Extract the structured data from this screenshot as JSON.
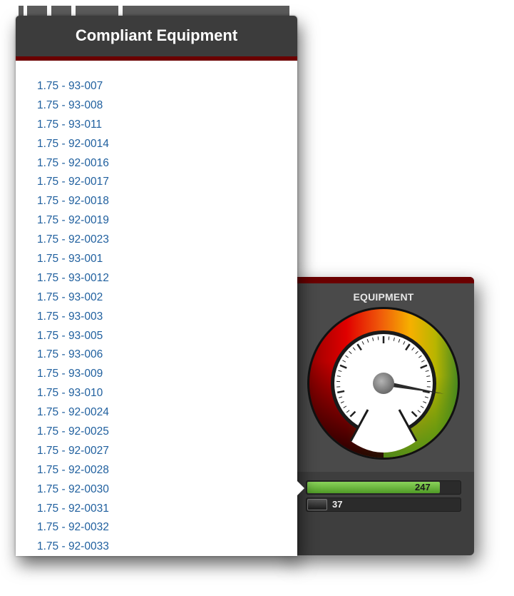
{
  "popup": {
    "title": "Compliant Equipment",
    "items": [
      "1.75 - 93-007",
      "1.75 - 93-008",
      "1.75 - 93-011",
      "1.75 - 92-0014",
      "1.75 - 92-0016",
      "1.75 - 92-0017",
      "1.75 - 92-0018",
      "1.75 - 92-0019",
      "1.75 - 92-0023",
      "1.75 - 93-001",
      "1.75 - 93-0012",
      "1.75 - 93-002",
      "1.75 - 93-003",
      "1.75 - 93-005",
      "1.75 - 93-006",
      "1.75 - 93-009",
      "1.75 - 93-010",
      "1.75 - 92-0024",
      "1.75 - 92-0025",
      "1.75 - 92-0027",
      "1.75 - 92-0028",
      "1.75 - 92-0030",
      "1.75 - 92-0031",
      "1.75 - 92-0032",
      "1.75 - 92-0033"
    ]
  },
  "gauge": {
    "title": "EQUIPMENT",
    "needle_fraction": 0.87,
    "bars": [
      {
        "value": "247",
        "fraction": 0.87,
        "color": "#6cb83d"
      },
      {
        "value": "37",
        "fraction": 0.13,
        "color": "#2a2a2a"
      }
    ]
  },
  "colors": {
    "header_bg": "#3c3c3c",
    "accent_stripe": "#6b0000",
    "link": "#1f5f9e",
    "panel_bg": "#4a4a4a"
  }
}
